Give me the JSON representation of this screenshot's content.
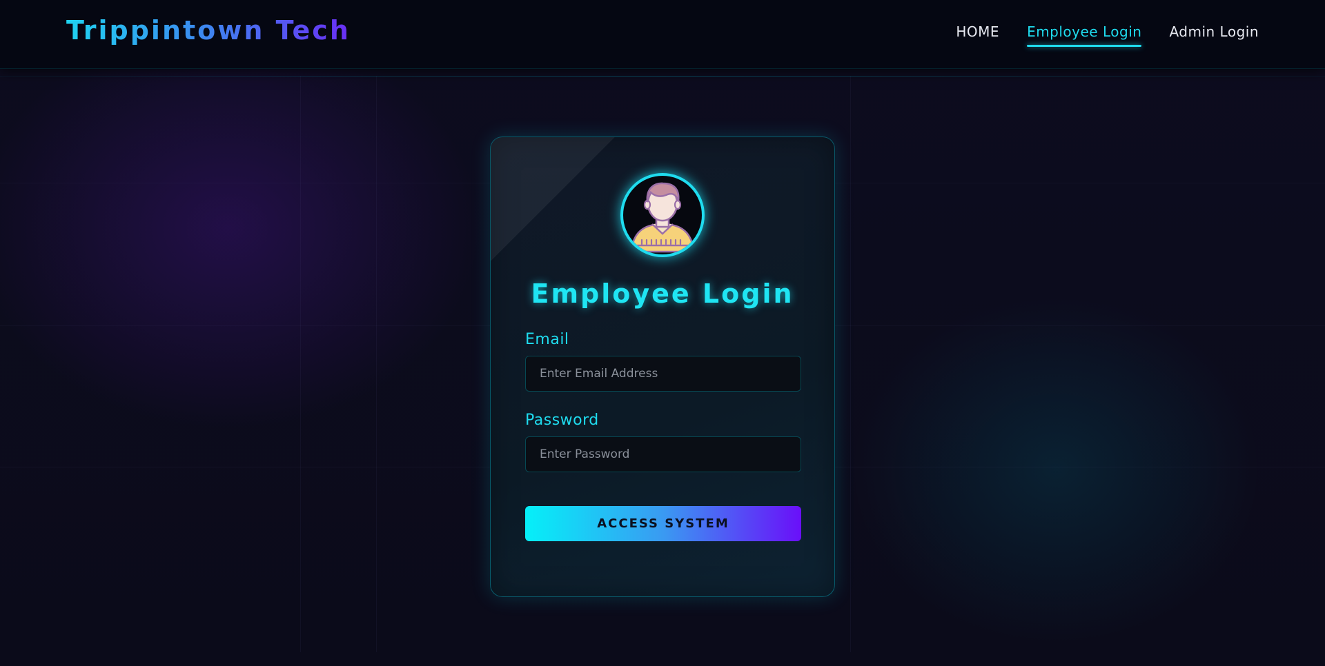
{
  "header": {
    "brand": "Trippintown Tech",
    "nav": [
      {
        "label": "HOME",
        "active": false
      },
      {
        "label": "Employee Login",
        "active": true
      },
      {
        "label": "Admin Login",
        "active": false
      }
    ]
  },
  "login": {
    "title": "Employee Login",
    "email_label": "Email",
    "email_placeholder": "Enter Email Address",
    "email_value": "",
    "password_label": "Password",
    "password_placeholder": "Enter Password",
    "password_value": "",
    "submit_label": "ACCESS SYSTEM",
    "avatar_icon": "user-avatar-icon"
  },
  "colors": {
    "accent_cyan": "#1fdcef",
    "accent_purple": "#6a0ff9",
    "background": "#0b0b18",
    "header": "#050712"
  }
}
